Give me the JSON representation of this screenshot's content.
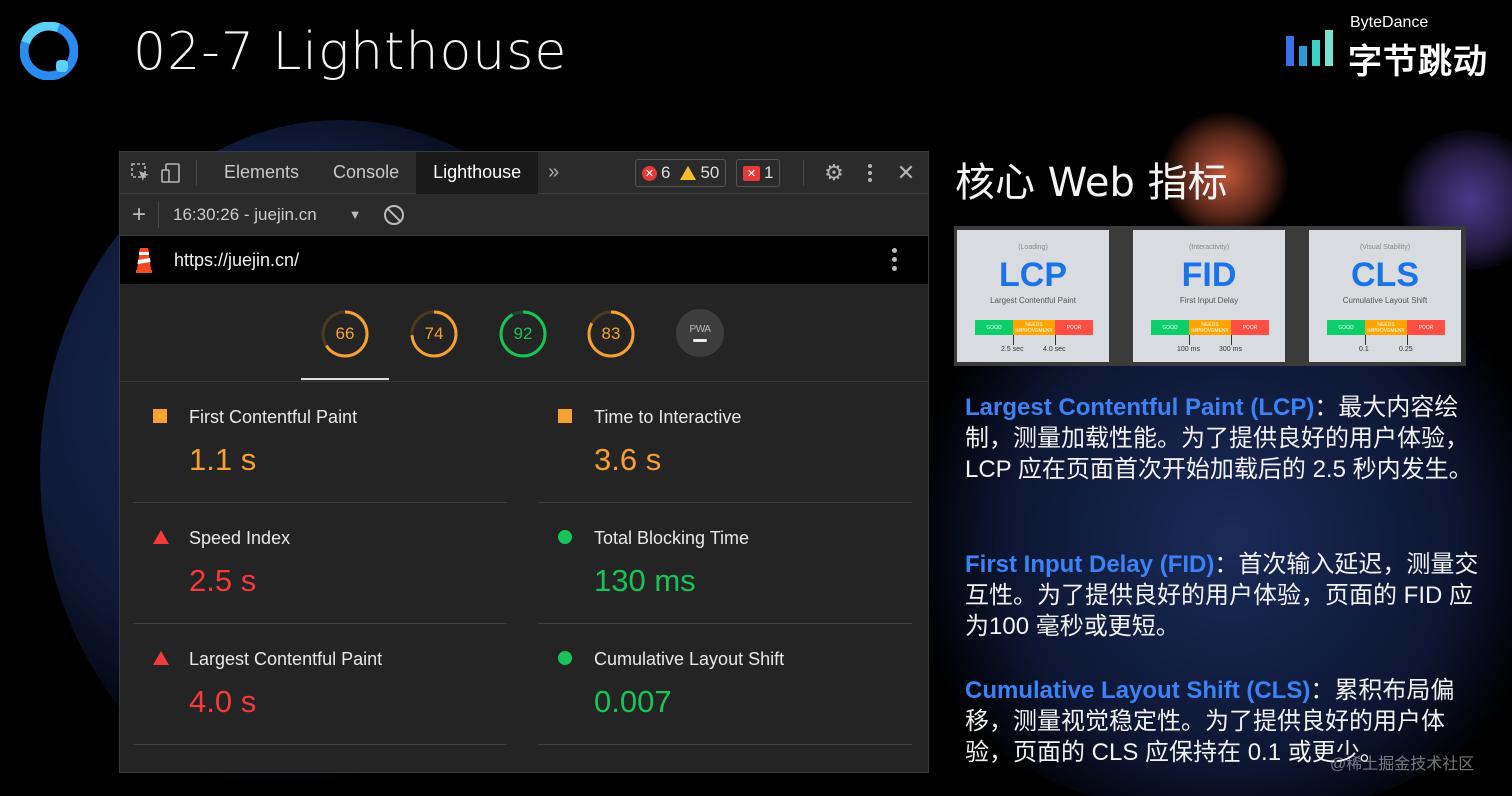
{
  "slide": {
    "title": "02-7 Lighthouse",
    "brand_en": "ByteDance",
    "brand_cn": "字节跳动",
    "corner_watermark": "@稀土掘金技术社区"
  },
  "devtools": {
    "tabs": [
      "Elements",
      "Console",
      "Lighthouse"
    ],
    "active_tab": "Lighthouse",
    "more_tabs_glyph": "»",
    "error_count": "6",
    "warning_count": "50",
    "issue_count": "1",
    "report_label": "16:30:26 - juejin.cn",
    "url": "https://juejin.cn/",
    "scores": [
      {
        "value": "66",
        "fraction": 0.66,
        "color": "#f5a030"
      },
      {
        "value": "74",
        "fraction": 0.74,
        "color": "#f5a030"
      },
      {
        "value": "92",
        "fraction": 0.92,
        "color": "#18c35a"
      },
      {
        "value": "83",
        "fraction": 0.83,
        "color": "#f5a030"
      }
    ],
    "pwa_label": "PWA",
    "metrics": [
      {
        "label": "First Contentful Paint",
        "value": "1.1 s",
        "status": "average"
      },
      {
        "label": "Time to Interactive",
        "value": "3.6 s",
        "status": "average"
      },
      {
        "label": "Speed Index",
        "value": "2.5 s",
        "status": "fail"
      },
      {
        "label": "Total Blocking Time",
        "value": "130 ms",
        "status": "pass"
      },
      {
        "label": "Largest Contentful Paint",
        "value": "4.0 s",
        "status": "fail"
      },
      {
        "label": "Cumulative Layout Shift",
        "value": "0.007",
        "status": "pass"
      }
    ]
  },
  "cwv": {
    "title": "核心 Web 指标",
    "cards": [
      {
        "category": "(Loading)",
        "abbr": "LCP",
        "name": "Largest Contentful Paint",
        "good": "GOOD",
        "needs": "NEEDS IMPROVEMENT",
        "poor": "POOR",
        "t1": "2.5 sec",
        "t2": "4.0 sec"
      },
      {
        "category": "(Interactivity)",
        "abbr": "FID",
        "name": "First Input Delay",
        "good": "GOOD",
        "needs": "NEEDS IMPROVEMENT",
        "poor": "POOR",
        "t1": "100 ms",
        "t2": "300 ms"
      },
      {
        "category": "(Visual Stability)",
        "abbr": "CLS",
        "name": "Cumulative Layout Shift",
        "good": "GOOD",
        "needs": "NEEDS IMPROVEMENT",
        "poor": "POOR",
        "t1": "0.1",
        "t2": "0.25"
      }
    ],
    "descriptions": [
      {
        "term": "Largest Contentful Paint (LCP)",
        "text": "：最大内容绘制，测量加载性能。为了提供良好的用户体验，LCP 应在页面首次开始加载后的 2.5 秒内发生。"
      },
      {
        "term": "First Input Delay (FID)",
        "text": "：首次输入延迟，测量交互性。为了提供良好的用户体验，页面的 FID 应为100 毫秒或更短。"
      },
      {
        "term": "Cumulative Layout Shift (CLS)",
        "text": "：累积布局偏移，测量视觉稳定性。为了提供良好的用户体验，页面的 CLS 应保持在 0.1 或更少。"
      }
    ]
  },
  "colors": {
    "accent_blue": "#3d82f5",
    "score_orange": "#f5a030",
    "score_green": "#18c35a",
    "score_red": "#f33b3b"
  }
}
